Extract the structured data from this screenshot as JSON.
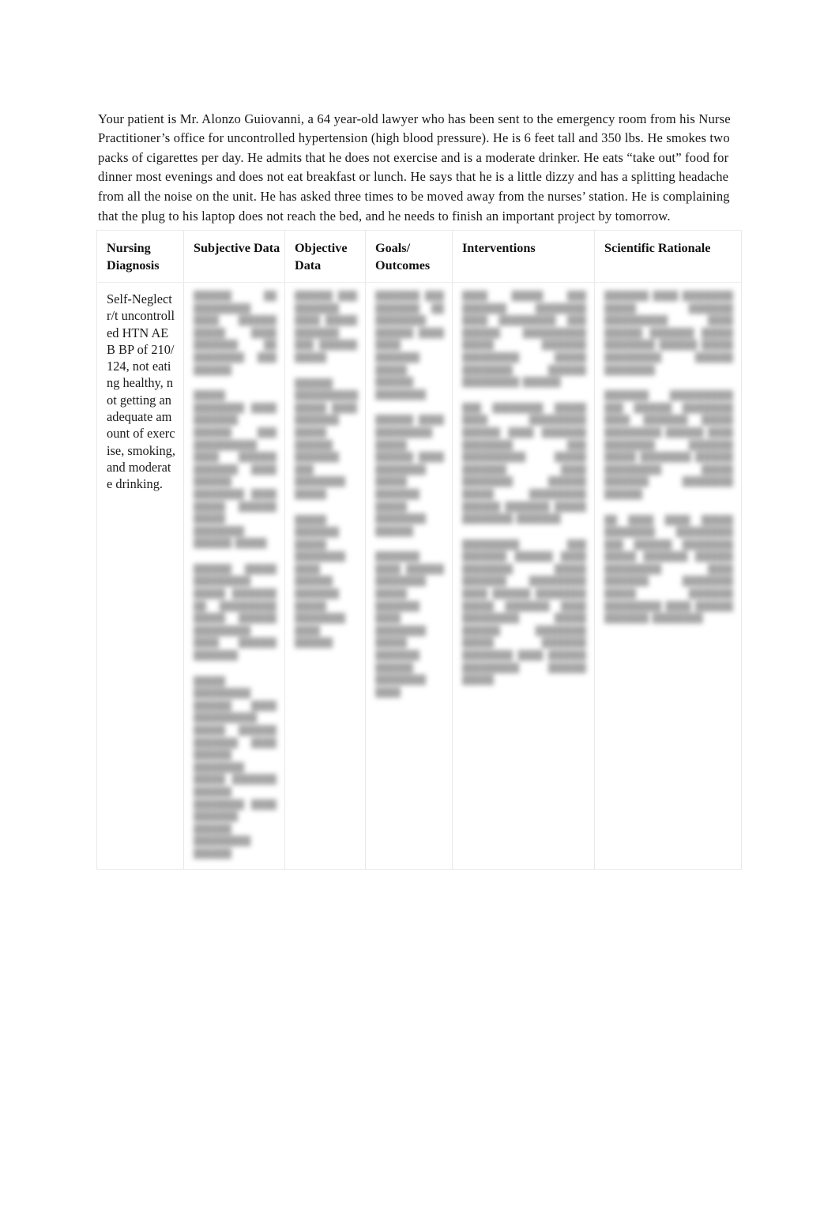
{
  "document": {
    "intro_paragraph": "Your patient is Mr. Alonzo Guiovanni, a 64 year-old lawyer who has been sent to the emergency room from his Nurse Practitioner’s office for uncontrolled hypertension (high blood pressure). He is 6 feet tall and 350 lbs. He smokes two packs of cigarettes per day. He admits that he does not exercise and is a moderate drinker. He eats “take out” food for dinner most evenings and does not eat breakfast or lunch. He says that he is a little dizzy and has a splitting headache from all the noise on the unit. He has asked three times to be moved away from the nurses’ station. He is complaining that the plug to his laptop does not reach the bed, and he needs to finish an important project by tomorrow."
  },
  "table": {
    "headers": {
      "nursing_diagnosis": "Nursing Diagnosis",
      "subjective_data": "Subjective Data",
      "objective_data": "Objective Data",
      "goals_outcomes": "Goals/ Outcomes",
      "interventions": "Interventions",
      "scientific_rationale": "Scientific Rationale"
    },
    "row": {
      "nursing_diagnosis": "Self-Neglect r/t uncontrolled HTN AEB BP of 210/124, not eating healthy, not getting an adequate amount of exercise, smoking, and moderate drinking.",
      "subjective_data": {
        "blurred": true,
        "paragraphs": [
          "██████ ██ █████████ ████ ██████ █████ ████ ███████ ██ ████████ ███ ██████",
          "█████ ████████ ████ ███████ ██████ ███ ██████████ ████ ██████ ███████ ████ ██████ ████████ ████ █████ ██████ █████ ████████ ██████ █████",
          "██████ █████ █████████ █████ ███████ ██ █████████ █████ ██████ █████████ ████ ██████ ███████",
          "█████ █████████ ██████ ████ ██████████ █████ ██████ ███████ ████ ██████ ████████ █████ ███████ ██████ ████████ ████ ███████ ██████ █████████ ██████"
        ]
      },
      "objective_data": {
        "blurred": true,
        "paragraphs": [
          "██████ ███ ███████ ████ █████ ███████ ███ ██████ █████",
          "██████ ██████████ █████ ████ ███████ █████ ██████ ███████ ███ ████████ █████",
          "█████ ███████ █████ ████████ ████ ██████ ███████ █████ ████████ ████ ██████"
        ]
      },
      "goals_outcomes": {
        "blurred": true,
        "paragraphs": [
          "███████ ███ ███████ ██ ████████ ██████ ████ ████ ███████ █████ ██████ ████████",
          "██████ ████ █████████ █████ ██████ ████ ████████ █████ ███████ █████ ████████ ██████",
          "███████ ████ ██████ ████████ █████ ███████ ████ ████████ █████ ███████ ██████ ████████ ████"
        ]
      },
      "interventions": {
        "blurred": true,
        "paragraphs": [
          "████ █████ ███ ███████ ████████ ████ █████████ ███ ██████ ██████████ █████ ███████ █████████ █████ ████████ ██████ █████████ ██████",
          "███ ████████ █████ ████ █████████ ██████ ████ ███████ ████████ ███ ██████████ █████ ███████ ████ ████████ ██████ █████ █████████ ██████ ███████ █████ ████████ ███████",
          "█████████ ███ ███████ ██████ ████ ████████ █████ ███████ █████████ ████ ██████ ████████ █████ ███████ ████ █████████ █████ ██████ ████████ █████ ███████ ████████ ████ ██████ █████████ ██████ █████"
        ]
      },
      "scientific_rationale": {
        "blurred": true,
        "paragraphs": [
          "███████ ████ ████████ █████ ███████ ██████████ ████ ██████ ███████ █████ ████████ ██████ █████ █████████ ██████ ████████",
          "███████ ██████████ ███ ██████ ████████ ████ ███████ █████ █████████ ██████ ████ ████████ ███████ █████ ████████ ██████ █████████ █████ ███████ ████████ ██████",
          "██ ████ ████ █████ ████████ █████████ ███ ██████ ████████ █████ ███████ ██████ █████████ ████ ███████ ████████ █████ ███████ █████████ ████ ██████ ███████ ████████"
        ]
      }
    }
  }
}
